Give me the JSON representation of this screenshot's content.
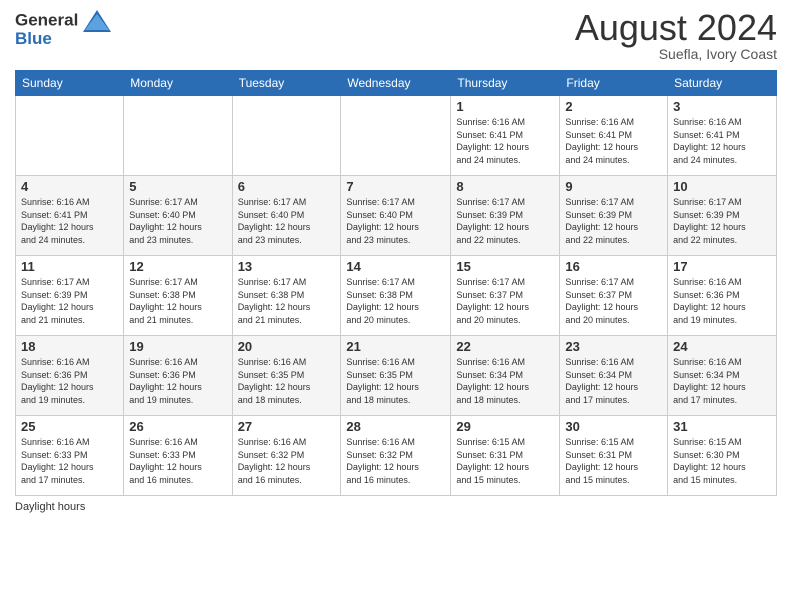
{
  "header": {
    "logo": {
      "general": "General",
      "blue": "Blue"
    },
    "title": "August 2024",
    "location": "Suefla, Ivory Coast"
  },
  "days_of_week": [
    "Sunday",
    "Monday",
    "Tuesday",
    "Wednesday",
    "Thursday",
    "Friday",
    "Saturday"
  ],
  "weeks": [
    [
      {
        "day": "",
        "info": ""
      },
      {
        "day": "",
        "info": ""
      },
      {
        "day": "",
        "info": ""
      },
      {
        "day": "",
        "info": ""
      },
      {
        "day": "1",
        "info": "Sunrise: 6:16 AM\nSunset: 6:41 PM\nDaylight: 12 hours\nand 24 minutes."
      },
      {
        "day": "2",
        "info": "Sunrise: 6:16 AM\nSunset: 6:41 PM\nDaylight: 12 hours\nand 24 minutes."
      },
      {
        "day": "3",
        "info": "Sunrise: 6:16 AM\nSunset: 6:41 PM\nDaylight: 12 hours\nand 24 minutes."
      }
    ],
    [
      {
        "day": "4",
        "info": "Sunrise: 6:16 AM\nSunset: 6:41 PM\nDaylight: 12 hours\nand 24 minutes."
      },
      {
        "day": "5",
        "info": "Sunrise: 6:17 AM\nSunset: 6:40 PM\nDaylight: 12 hours\nand 23 minutes."
      },
      {
        "day": "6",
        "info": "Sunrise: 6:17 AM\nSunset: 6:40 PM\nDaylight: 12 hours\nand 23 minutes."
      },
      {
        "day": "7",
        "info": "Sunrise: 6:17 AM\nSunset: 6:40 PM\nDaylight: 12 hours\nand 23 minutes."
      },
      {
        "day": "8",
        "info": "Sunrise: 6:17 AM\nSunset: 6:39 PM\nDaylight: 12 hours\nand 22 minutes."
      },
      {
        "day": "9",
        "info": "Sunrise: 6:17 AM\nSunset: 6:39 PM\nDaylight: 12 hours\nand 22 minutes."
      },
      {
        "day": "10",
        "info": "Sunrise: 6:17 AM\nSunset: 6:39 PM\nDaylight: 12 hours\nand 22 minutes."
      }
    ],
    [
      {
        "day": "11",
        "info": "Sunrise: 6:17 AM\nSunset: 6:39 PM\nDaylight: 12 hours\nand 21 minutes."
      },
      {
        "day": "12",
        "info": "Sunrise: 6:17 AM\nSunset: 6:38 PM\nDaylight: 12 hours\nand 21 minutes."
      },
      {
        "day": "13",
        "info": "Sunrise: 6:17 AM\nSunset: 6:38 PM\nDaylight: 12 hours\nand 21 minutes."
      },
      {
        "day": "14",
        "info": "Sunrise: 6:17 AM\nSunset: 6:38 PM\nDaylight: 12 hours\nand 20 minutes."
      },
      {
        "day": "15",
        "info": "Sunrise: 6:17 AM\nSunset: 6:37 PM\nDaylight: 12 hours\nand 20 minutes."
      },
      {
        "day": "16",
        "info": "Sunrise: 6:17 AM\nSunset: 6:37 PM\nDaylight: 12 hours\nand 20 minutes."
      },
      {
        "day": "17",
        "info": "Sunrise: 6:16 AM\nSunset: 6:36 PM\nDaylight: 12 hours\nand 19 minutes."
      }
    ],
    [
      {
        "day": "18",
        "info": "Sunrise: 6:16 AM\nSunset: 6:36 PM\nDaylight: 12 hours\nand 19 minutes."
      },
      {
        "day": "19",
        "info": "Sunrise: 6:16 AM\nSunset: 6:36 PM\nDaylight: 12 hours\nand 19 minutes."
      },
      {
        "day": "20",
        "info": "Sunrise: 6:16 AM\nSunset: 6:35 PM\nDaylight: 12 hours\nand 18 minutes."
      },
      {
        "day": "21",
        "info": "Sunrise: 6:16 AM\nSunset: 6:35 PM\nDaylight: 12 hours\nand 18 minutes."
      },
      {
        "day": "22",
        "info": "Sunrise: 6:16 AM\nSunset: 6:34 PM\nDaylight: 12 hours\nand 18 minutes."
      },
      {
        "day": "23",
        "info": "Sunrise: 6:16 AM\nSunset: 6:34 PM\nDaylight: 12 hours\nand 17 minutes."
      },
      {
        "day": "24",
        "info": "Sunrise: 6:16 AM\nSunset: 6:34 PM\nDaylight: 12 hours\nand 17 minutes."
      }
    ],
    [
      {
        "day": "25",
        "info": "Sunrise: 6:16 AM\nSunset: 6:33 PM\nDaylight: 12 hours\nand 17 minutes."
      },
      {
        "day": "26",
        "info": "Sunrise: 6:16 AM\nSunset: 6:33 PM\nDaylight: 12 hours\nand 16 minutes."
      },
      {
        "day": "27",
        "info": "Sunrise: 6:16 AM\nSunset: 6:32 PM\nDaylight: 12 hours\nand 16 minutes."
      },
      {
        "day": "28",
        "info": "Sunrise: 6:16 AM\nSunset: 6:32 PM\nDaylight: 12 hours\nand 16 minutes."
      },
      {
        "day": "29",
        "info": "Sunrise: 6:15 AM\nSunset: 6:31 PM\nDaylight: 12 hours\nand 15 minutes."
      },
      {
        "day": "30",
        "info": "Sunrise: 6:15 AM\nSunset: 6:31 PM\nDaylight: 12 hours\nand 15 minutes."
      },
      {
        "day": "31",
        "info": "Sunrise: 6:15 AM\nSunset: 6:30 PM\nDaylight: 12 hours\nand 15 minutes."
      }
    ]
  ],
  "footer": {
    "daylight_label": "Daylight hours"
  }
}
